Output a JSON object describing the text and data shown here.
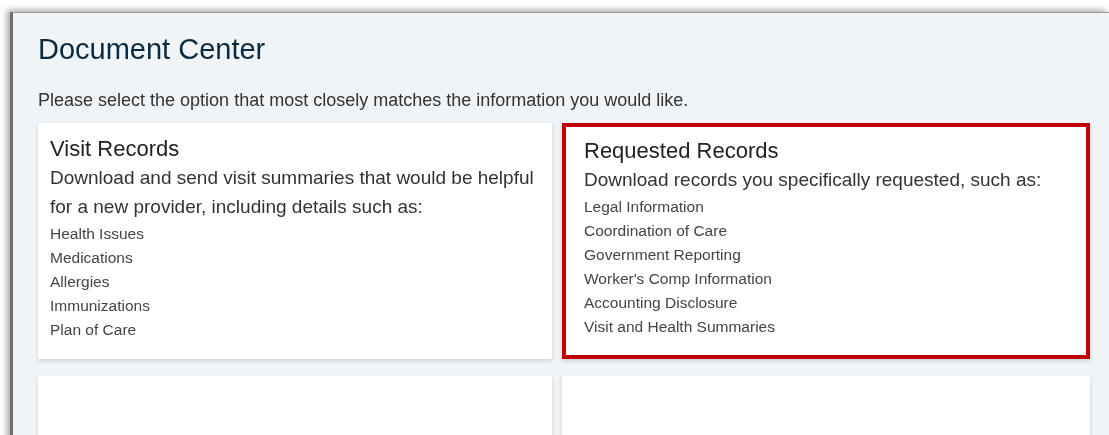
{
  "page": {
    "title": "Document Center",
    "instructions": "Please select the option that most closely matches the information you would like."
  },
  "cards": [
    {
      "title": "Visit Records",
      "description": "Download and send visit summaries that would be helpful for a new provider, including details such as:",
      "items": [
        "Health Issues",
        "Medications",
        "Allergies",
        "Immunizations",
        "Plan of Care"
      ],
      "highlighted": false
    },
    {
      "title": "Requested Records",
      "description": "Download records you specifically requested, such as:",
      "items": [
        "Legal Information",
        "Coordination of Care",
        "Government Reporting",
        "Worker's Comp Information",
        "Accounting Disclosure",
        "Visit and Health Summaries"
      ],
      "highlighted": true
    },
    {
      "highlighted": false
    },
    {
      "highlighted": false
    }
  ]
}
